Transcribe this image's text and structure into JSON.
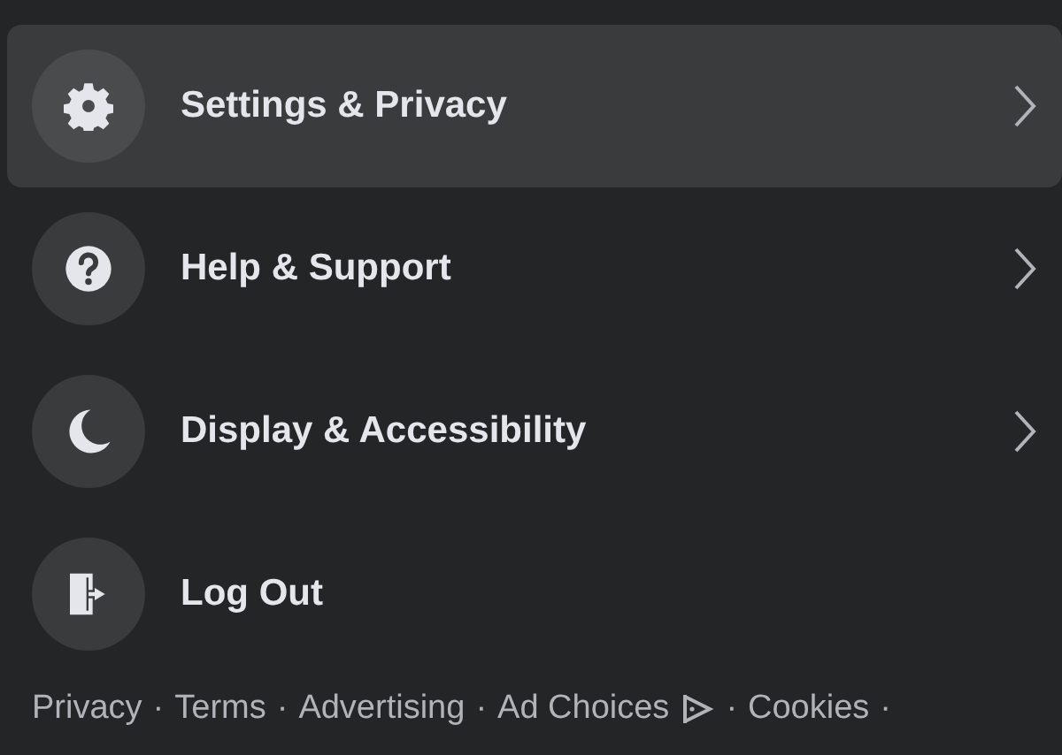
{
  "menu_items": [
    {
      "label": "Settings & Privacy",
      "kind": "submenu",
      "selected": true
    },
    {
      "label": "Help & Support",
      "kind": "submenu",
      "selected": false
    },
    {
      "label": "Display & Accessibility",
      "kind": "submenu",
      "selected": false
    },
    {
      "label": "Log Out",
      "kind": "action",
      "selected": false
    }
  ],
  "footer": {
    "separator": "·",
    "links": [
      "Privacy",
      "Terms",
      "Advertising",
      "Ad Choices",
      "Cookies"
    ]
  }
}
